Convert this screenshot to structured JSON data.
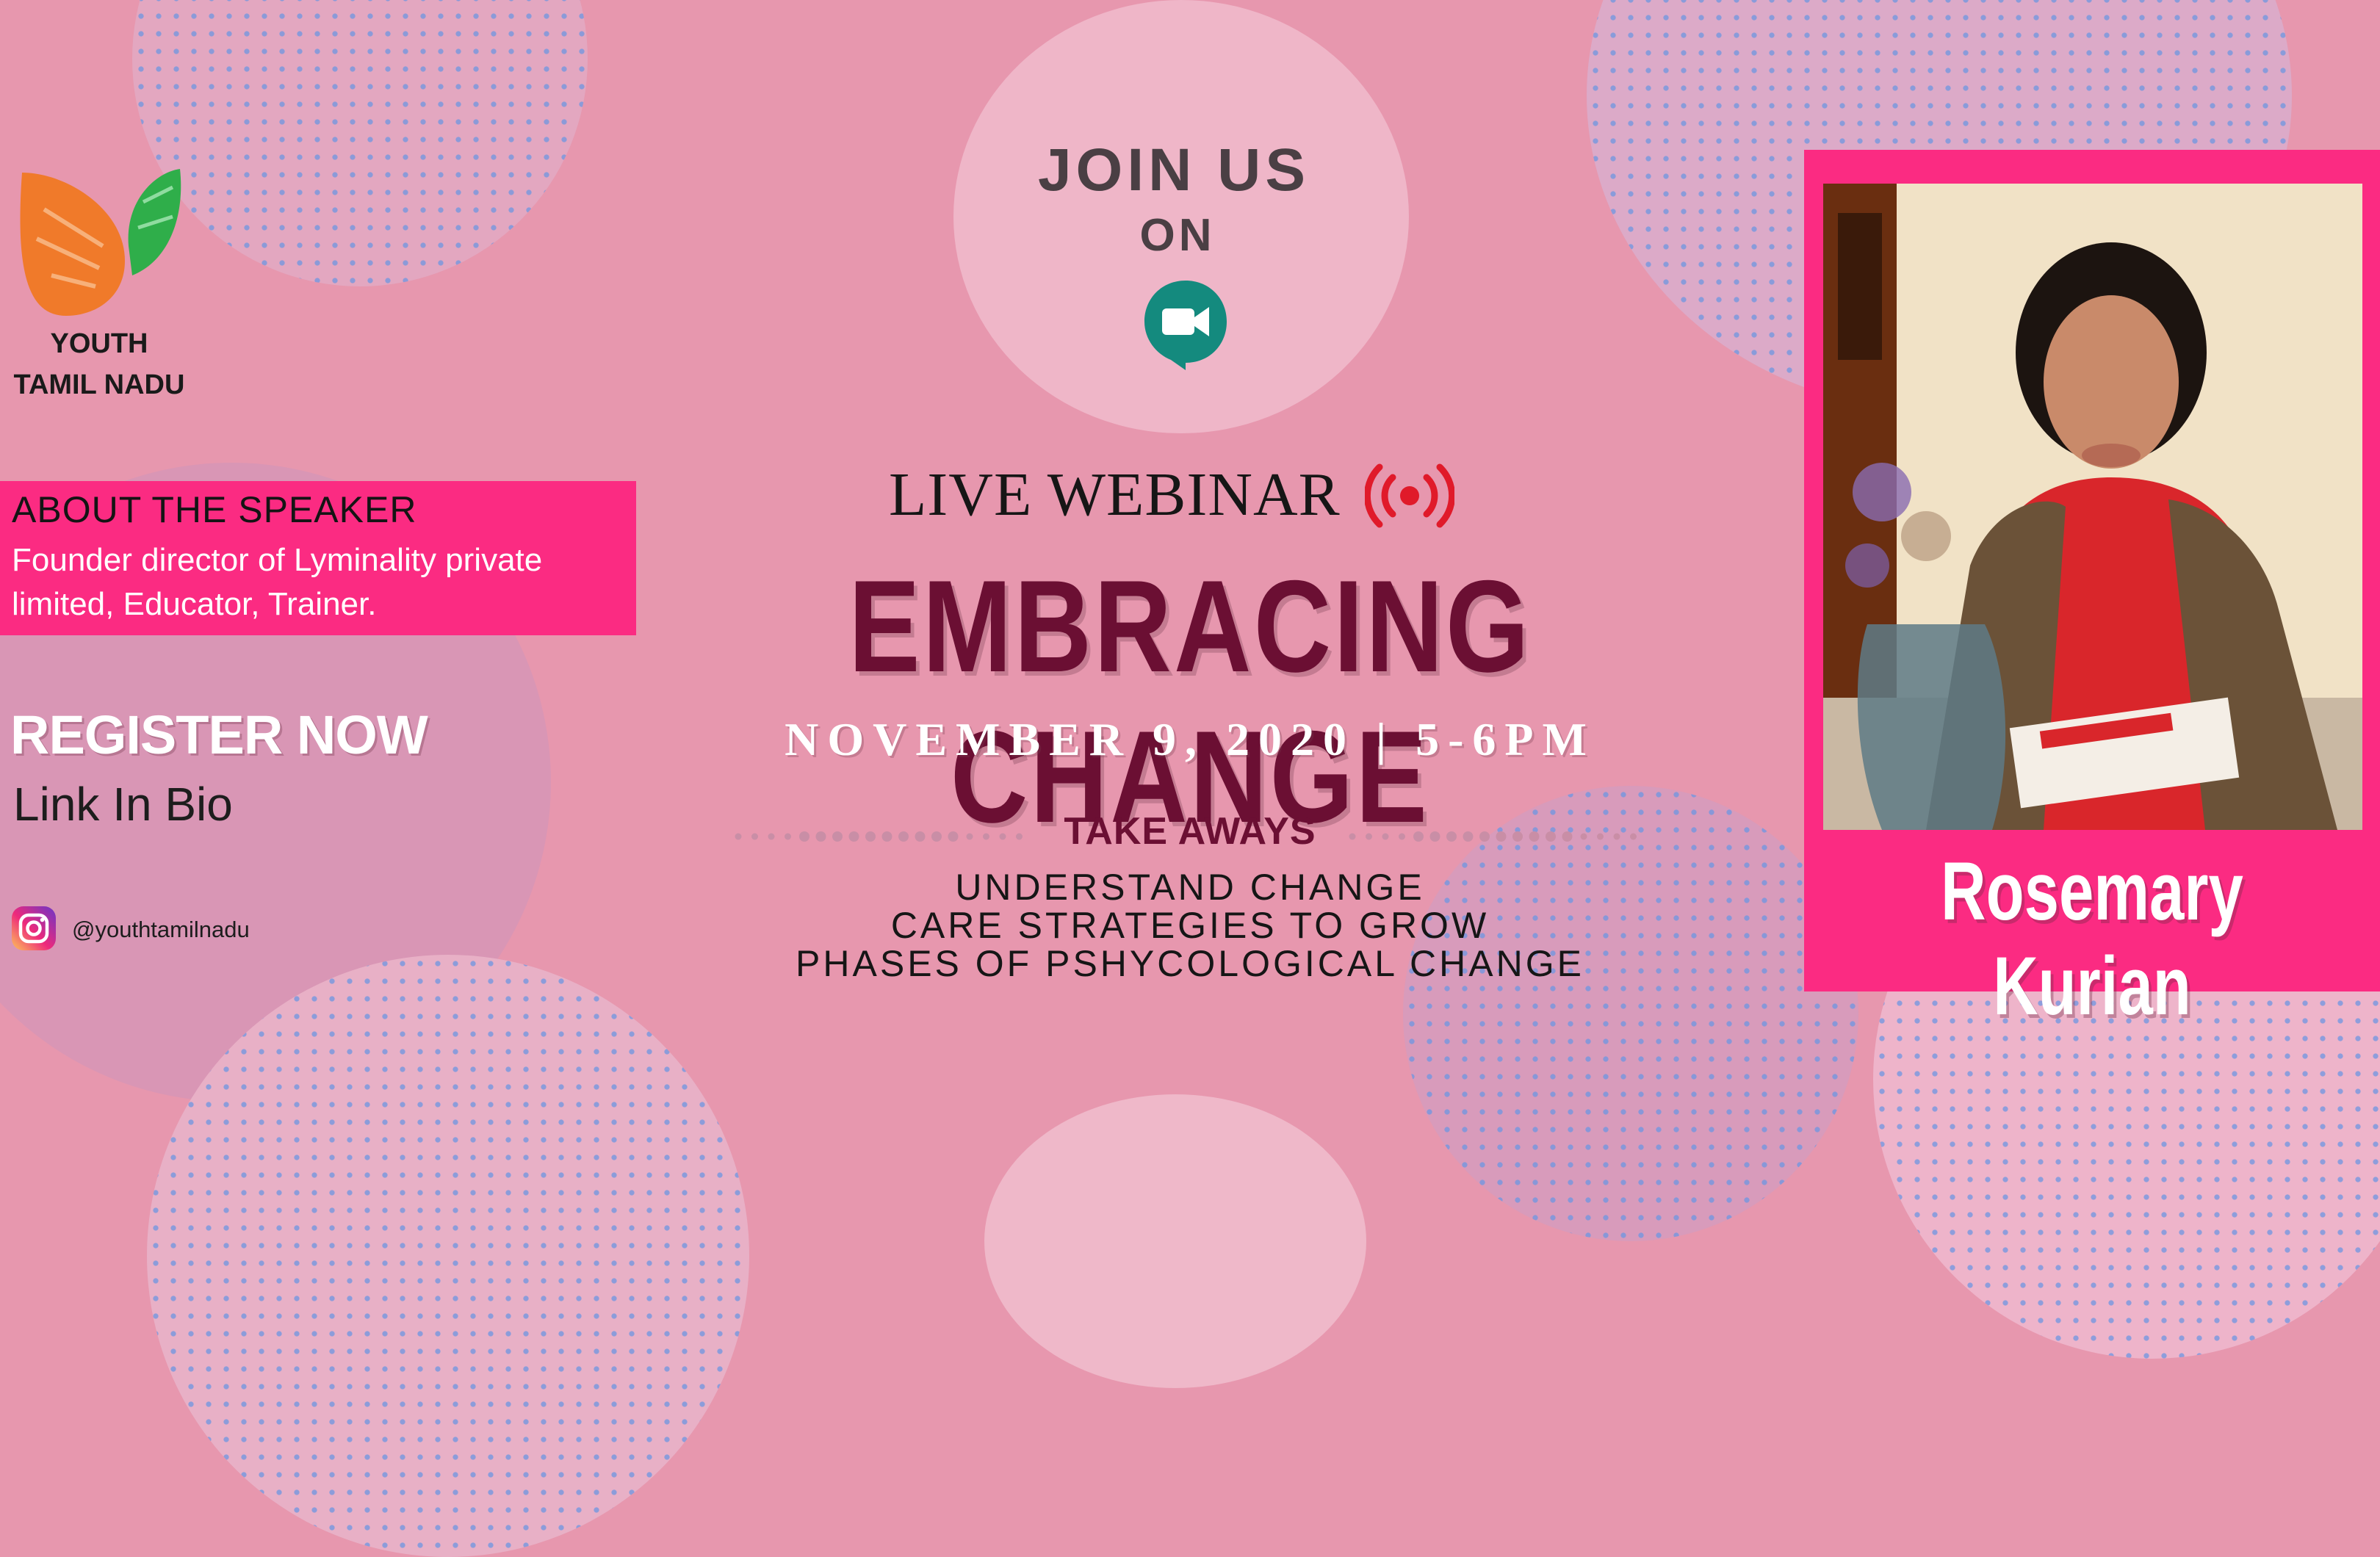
{
  "brand": {
    "name_line1": "YOUTH",
    "name_line2": "TAMIL NADU",
    "colors": {
      "orange": "#f07a2a",
      "green": "#2fae4a"
    }
  },
  "speaker_box": {
    "heading": "ABOUT THE SPEAKER",
    "description": "Founder director of Lyminality private limited, Educator, Trainer."
  },
  "register": {
    "label": "REGISTER NOW",
    "sub": "Link In Bio"
  },
  "social": {
    "icon": "instagram-icon",
    "handle": "@youthtamilnadu"
  },
  "join": {
    "line1": "JOIN US",
    "line2": "ON",
    "icon": "google-meet-icon"
  },
  "webinar": {
    "label": "LIVE WEBINAR",
    "icon": "live-broadcast-icon",
    "title": "EMBRACING CHANGE",
    "date": "NOVEMBER 9, 2020 | 5-6PM",
    "takeaways_heading": "TAKE AWAYS",
    "takeaways": [
      "UNDERSTAND CHANGE",
      "CARE STRATEGIES TO GROW",
      "PHASES OF PSHYCOLOGICAL CHANGE"
    ]
  },
  "speaker": {
    "name": "Rosemary Kurian"
  },
  "colors": {
    "background": "#e797ae",
    "accent_pink": "#fb2b82",
    "title_maroon": "#6b0f33",
    "live_red": "#e01a2a"
  }
}
